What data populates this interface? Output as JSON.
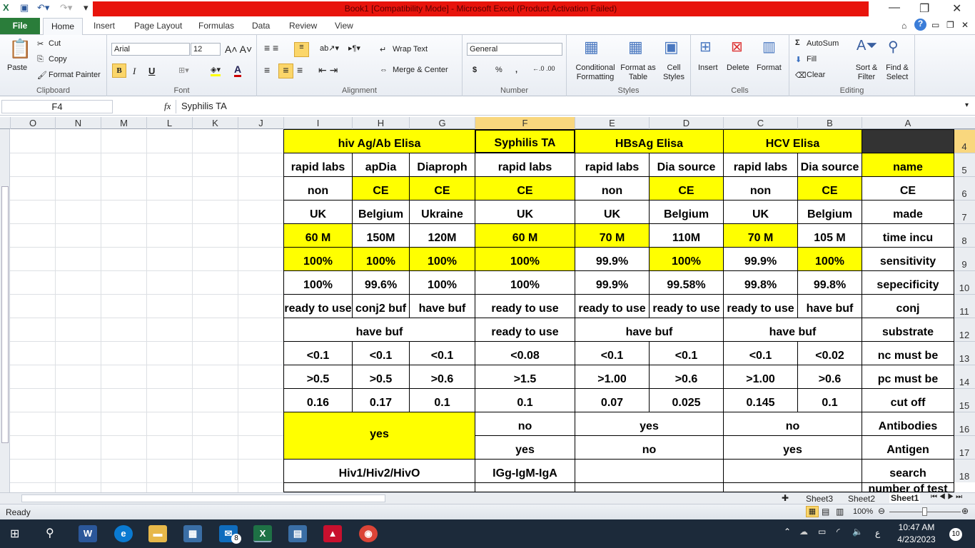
{
  "window": {
    "title": "Book1  [Compatibility Mode]  -  Microsoft Excel (Product Activation Failed)"
  },
  "ribbon_tabs": [
    "File",
    "Home",
    "Insert",
    "Page Layout",
    "Formulas",
    "Data",
    "Review",
    "View"
  ],
  "clipboard": {
    "paste": "Paste",
    "cut": "Cut",
    "copy": "Copy",
    "format_painter": "Format Painter",
    "label": "Clipboard"
  },
  "font": {
    "name": "Arial",
    "size": "12",
    "label": "Font",
    "bold": "B",
    "italic": "I",
    "underline": "U"
  },
  "alignment": {
    "wrap": "Wrap Text",
    "merge": "Merge & Center",
    "label": "Alignment"
  },
  "number": {
    "format": "General",
    "label": "Number",
    "currency": "$",
    "percent": "%",
    "comma": ","
  },
  "styles": {
    "conditional": "Conditional Formatting",
    "format_table": "Format as Table",
    "cell_styles": "Cell Styles",
    "label": "Styles"
  },
  "cells": {
    "insert": "Insert",
    "delete": "Delete",
    "format": "Format",
    "label": "Cells"
  },
  "editing": {
    "autosum": "AutoSum",
    "fill": "Fill",
    "clear": "Clear",
    "sort": "Sort & Filter",
    "find": "Find & Select",
    "label": "Editing"
  },
  "formula_bar": {
    "name_box": "F4",
    "fx": "fx",
    "value": "Syphilis TA"
  },
  "columns": [
    "O",
    "N",
    "M",
    "L",
    "K",
    "J",
    "I",
    "H",
    "G",
    "F",
    "E",
    "D",
    "C",
    "B",
    "A"
  ],
  "rows": [
    "4",
    "5",
    "6",
    "7",
    "8",
    "9",
    "10",
    "11",
    "12",
    "13",
    "14",
    "15",
    "16",
    "17",
    "18"
  ],
  "table": [
    {
      "row": 4,
      "cells": [
        {
          "c": "I",
          "span": 3,
          "t": "hiv Ag/Ab Elisa",
          "y": true
        },
        {
          "c": "F",
          "t": "Syphilis TA",
          "y": true
        },
        {
          "c": "E",
          "span": 2,
          "t": "HBsAg Elisa",
          "y": true
        },
        {
          "c": "C",
          "span": 2,
          "t": "HCV Elisa",
          "y": true
        },
        {
          "c": "A",
          "t": "",
          "dark": true
        }
      ]
    },
    {
      "row": 5,
      "cells": [
        {
          "c": "I",
          "t": "rapid labs"
        },
        {
          "c": "H",
          "t": "apDia"
        },
        {
          "c": "G",
          "t": "Diaproph"
        },
        {
          "c": "F",
          "t": "rapid labs"
        },
        {
          "c": "E",
          "t": "rapid labs"
        },
        {
          "c": "D",
          "t": "Dia source"
        },
        {
          "c": "C",
          "t": "rapid labs"
        },
        {
          "c": "B",
          "t": "Dia source"
        },
        {
          "c": "A",
          "t": "name",
          "y": true
        }
      ]
    },
    {
      "row": 6,
      "cells": [
        {
          "c": "I",
          "t": "non"
        },
        {
          "c": "H",
          "t": "CE",
          "y": true
        },
        {
          "c": "G",
          "t": "CE",
          "y": true
        },
        {
          "c": "F",
          "t": "CE",
          "y": true
        },
        {
          "c": "E",
          "t": "non"
        },
        {
          "c": "D",
          "t": "CE",
          "y": true
        },
        {
          "c": "C",
          "t": "non"
        },
        {
          "c": "B",
          "t": "CE",
          "y": true
        },
        {
          "c": "A",
          "t": "CE"
        }
      ]
    },
    {
      "row": 7,
      "cells": [
        {
          "c": "I",
          "t": "UK"
        },
        {
          "c": "H",
          "t": "Belgium"
        },
        {
          "c": "G",
          "t": "Ukraine"
        },
        {
          "c": "F",
          "t": "UK"
        },
        {
          "c": "E",
          "t": "UK"
        },
        {
          "c": "D",
          "t": "Belgium"
        },
        {
          "c": "C",
          "t": "UK"
        },
        {
          "c": "B",
          "t": "Belgium"
        },
        {
          "c": "A",
          "t": "made"
        }
      ]
    },
    {
      "row": 8,
      "cells": [
        {
          "c": "I",
          "t": "60 M",
          "y": true
        },
        {
          "c": "H",
          "t": "150M"
        },
        {
          "c": "G",
          "t": "120M"
        },
        {
          "c": "F",
          "t": "60 M",
          "y": true
        },
        {
          "c": "E",
          "t": "70 M",
          "y": true
        },
        {
          "c": "D",
          "t": "110M"
        },
        {
          "c": "C",
          "t": "70 M",
          "y": true
        },
        {
          "c": "B",
          "t": "105 M"
        },
        {
          "c": "A",
          "t": "time incu"
        }
      ]
    },
    {
      "row": 9,
      "cells": [
        {
          "c": "I",
          "t": "100%",
          "y": true
        },
        {
          "c": "H",
          "t": "100%",
          "y": true
        },
        {
          "c": "G",
          "t": "100%",
          "y": true
        },
        {
          "c": "F",
          "t": "100%",
          "y": true
        },
        {
          "c": "E",
          "t": "99.9%"
        },
        {
          "c": "D",
          "t": "100%",
          "y": true
        },
        {
          "c": "C",
          "t": "99.9%"
        },
        {
          "c": "B",
          "t": "100%",
          "y": true
        },
        {
          "c": "A",
          "t": "sensitivity"
        }
      ]
    },
    {
      "row": 10,
      "cells": [
        {
          "c": "I",
          "t": "100%"
        },
        {
          "c": "H",
          "t": "99.6%"
        },
        {
          "c": "G",
          "t": "100%"
        },
        {
          "c": "F",
          "t": "100%"
        },
        {
          "c": "E",
          "t": "99.9%"
        },
        {
          "c": "D",
          "t": "99.58%"
        },
        {
          "c": "C",
          "t": "99.8%"
        },
        {
          "c": "B",
          "t": "99.8%"
        },
        {
          "c": "A",
          "t": "sepecificity"
        }
      ]
    },
    {
      "row": 11,
      "cells": [
        {
          "c": "I",
          "t": "ready to use"
        },
        {
          "c": "H",
          "t": "conj2 buf"
        },
        {
          "c": "G",
          "t": "have buf"
        },
        {
          "c": "F",
          "t": "ready to use"
        },
        {
          "c": "E",
          "t": "ready to use"
        },
        {
          "c": "D",
          "t": "ready to use"
        },
        {
          "c": "C",
          "t": "ready to use"
        },
        {
          "c": "B",
          "t": "have buf"
        },
        {
          "c": "A",
          "t": "conj"
        }
      ]
    },
    {
      "row": 12,
      "cells": [
        {
          "c": "I",
          "span": 3,
          "t": "have buf"
        },
        {
          "c": "F",
          "t": "ready to use"
        },
        {
          "c": "E",
          "span": 2,
          "t": "have buf"
        },
        {
          "c": "C",
          "span": 2,
          "t": "have buf"
        },
        {
          "c": "A",
          "t": "substrate"
        }
      ]
    },
    {
      "row": 13,
      "cells": [
        {
          "c": "I",
          "t": "<0.1"
        },
        {
          "c": "H",
          "t": "<0.1"
        },
        {
          "c": "G",
          "t": "<0.1"
        },
        {
          "c": "F",
          "t": "<0.08"
        },
        {
          "c": "E",
          "t": "<0.1"
        },
        {
          "c": "D",
          "t": "<0.1"
        },
        {
          "c": "C",
          "t": "<0.1"
        },
        {
          "c": "B",
          "t": "<0.02"
        },
        {
          "c": "A",
          "t": "nc must be"
        }
      ]
    },
    {
      "row": 14,
      "cells": [
        {
          "c": "I",
          "t": ">0.5"
        },
        {
          "c": "H",
          "t": ">0.5"
        },
        {
          "c": "G",
          "t": ">0.6"
        },
        {
          "c": "F",
          "t": ">1.5"
        },
        {
          "c": "E",
          "t": ">1.00"
        },
        {
          "c": "D",
          "t": ">0.6"
        },
        {
          "c": "C",
          "t": ">1.00"
        },
        {
          "c": "B",
          "t": ">0.6"
        },
        {
          "c": "A",
          "t": "pc must be"
        }
      ]
    },
    {
      "row": 15,
      "cells": [
        {
          "c": "I",
          "t": "0.16"
        },
        {
          "c": "H",
          "t": "0.17"
        },
        {
          "c": "G",
          "t": "0.1"
        },
        {
          "c": "F",
          "t": "0.1"
        },
        {
          "c": "E",
          "t": "0.07"
        },
        {
          "c": "D",
          "t": "0.025"
        },
        {
          "c": "C",
          "t": "0.145"
        },
        {
          "c": "B",
          "t": "0.1"
        },
        {
          "c": "A",
          "t": "cut off"
        }
      ]
    },
    {
      "row": 16,
      "cells": [
        {
          "c": "I",
          "span": 3,
          "rspan": 2,
          "t": "yes",
          "y": true,
          "mid": true
        },
        {
          "c": "F",
          "t": "no"
        },
        {
          "c": "E",
          "span": 2,
          "t": "yes"
        },
        {
          "c": "C",
          "span": 2,
          "t": "no"
        },
        {
          "c": "A",
          "t": "Antibodies"
        }
      ]
    },
    {
      "row": 17,
      "cells": [
        {
          "c": "F",
          "t": "yes"
        },
        {
          "c": "E",
          "span": 2,
          "t": "no"
        },
        {
          "c": "C",
          "span": 2,
          "t": "yes"
        },
        {
          "c": "A",
          "t": "Antigen"
        }
      ]
    },
    {
      "row": 18,
      "cells": [
        {
          "c": "I",
          "span": 3,
          "t": "Hiv1/Hiv2/HivO"
        },
        {
          "c": "F",
          "t": "IGg-IgM-IgA"
        },
        {
          "c": "E",
          "span": 2,
          "t": ""
        },
        {
          "c": "C",
          "span": 2,
          "t": ""
        },
        {
          "c": "A",
          "t": "search"
        }
      ]
    },
    {
      "row": 19,
      "cells": [
        {
          "c": "I",
          "span": 3,
          "t": ""
        },
        {
          "c": "F",
          "t": ""
        },
        {
          "c": "E",
          "span": 2,
          "t": ""
        },
        {
          "c": "C",
          "span": 2,
          "t": ""
        },
        {
          "c": "A",
          "t": "number of test"
        }
      ]
    }
  ],
  "sheets": [
    "Sheet3",
    "Sheet2",
    "Sheet1"
  ],
  "status": {
    "ready": "Ready",
    "zoom": "100%",
    "zoom_fraction": 0.5
  },
  "taskbar": {
    "time": "10:47 AM",
    "date": "4/23/2023",
    "lang": "ع",
    "notifications": "10",
    "mail_badge": "8"
  },
  "colors": {
    "yellow": "#ffff00",
    "title_red": "#e8140c",
    "file_green": "#2a7d3a"
  }
}
